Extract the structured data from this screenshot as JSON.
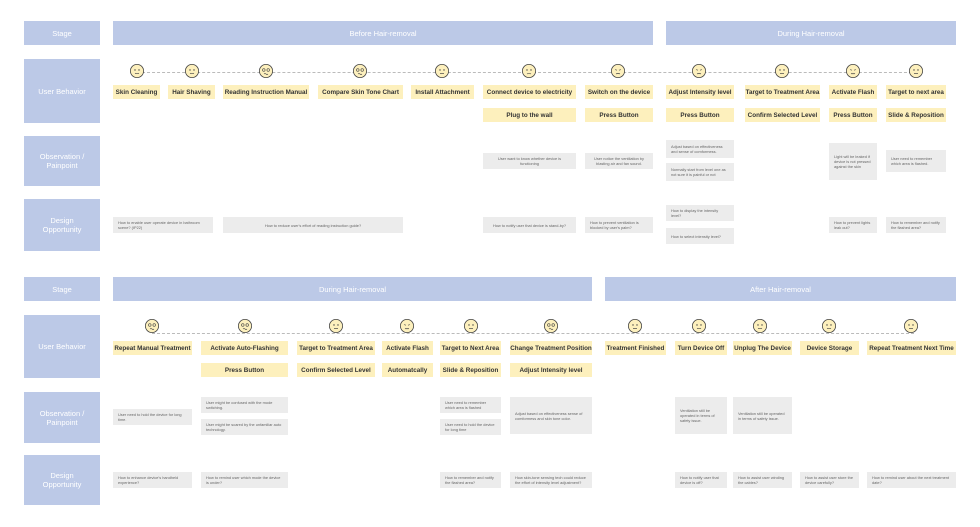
{
  "row_labels": {
    "stage": "Stage",
    "user_behavior": "User Behavior",
    "observation": "Observation /\nPainpoint",
    "design": "Design\nOpportunity"
  },
  "top": {
    "stages": [
      "Before Hair-removal",
      "During Hair-removal"
    ],
    "steps": [
      "Skin Cleaning",
      "Hair Shaving",
      "Reading Instruction Manual",
      "Compare Skin Tone Chart",
      "Install Attachment",
      "Connect device to electricity",
      "Switch on the device",
      "Adjust Intensity level",
      "Target to Treatment Area",
      "Activate Flash",
      "Target to next area"
    ],
    "substeps": [
      "Plug to the wall",
      "Press Button",
      "Press Button",
      "Confirm Selected Level",
      "Press Button",
      "Slide & Reposition"
    ],
    "observations": [
      "User want to know whether device is functioning",
      "User notice the ventilation by blasting air and fan sound.",
      "Adjust based on effectiveness and sense of comformess.",
      "Normally start from level one as not sure it is painful or not",
      "Light will be leaked if device is not pressed against the skin",
      "User need to remember which area is flashed."
    ],
    "opportunities": [
      "How to enable user operate device in bathroom scene? (IP22)",
      "How to reduce user's effort of reading instruction guide?",
      "How to notify user that device is stand-by?",
      "How to prevent ventilation is blocked by user's palm?",
      "How to display the intensity level?",
      "How to select intensity level?",
      "How to prevent lights leak out?",
      "How to remember and notify the flashed area?"
    ]
  },
  "bottom": {
    "stages": [
      "During Hair-removal",
      "After Hair-removal"
    ],
    "steps": [
      "Repeat Manual Treatment",
      "Activate Auto-Flashing",
      "Target to Treatment Area",
      "Activate Flash",
      "Target to Next Area",
      "Change Treatment Position",
      "Treatment Finished",
      "Turn Device Off",
      "Unplug The Device",
      "Device Storage",
      "Repeat Treatment Next Time"
    ],
    "substeps": [
      "Press Button",
      "Confirm Selected Level",
      "Automatcally",
      "Slide & Reposition",
      "Adjust Intensity level"
    ],
    "observations": [
      "User need to hold the device for long time.",
      "User might be confused with the mode switching.",
      "User might be scared by the unfamiliar auto technology.",
      "User need to remember which area is flashed",
      "User need to hold the device for long time",
      "Adjust based on effectiveness sense of comformess and skin tone color.",
      "Ventilation still be operated in terms of safety issue.",
      "Ventilation still be operated in terms of safety issue."
    ],
    "opportunities": [
      "How to enhance device's handheld experience?",
      "How to remind user which mode the device is under?",
      "How to remember and notify the flashed area?",
      "How skin-tone sensing tech could reduce the effort of intensity level adjustment?",
      "How to notify user that device is off?",
      "How to assist user winding the cables?",
      "How to assist user store the device carefully?",
      "How to remind user about the next treatment date?"
    ]
  },
  "colors": {
    "label_bg": "#bcc9e7",
    "card_bg": "#fdf0bd",
    "note_bg": "#ececec",
    "face_fill": "#fdf0bd"
  }
}
